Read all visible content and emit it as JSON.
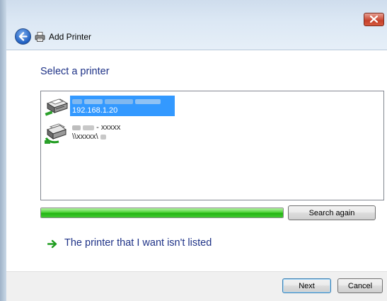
{
  "window": {
    "title": "Add Printer",
    "close_icon": "close-icon",
    "back_icon": "back-arrow-icon"
  },
  "main": {
    "heading": "Select a printer",
    "printers": [
      {
        "name_redacted": true,
        "address": "192.168.1.20",
        "selected": true,
        "icon": "network-printer-icon"
      },
      {
        "name_suffix": "- xxxxx",
        "path": "\\\\xxxxx\\",
        "selected": false,
        "icon": "shared-printer-icon"
      }
    ],
    "search_progress": 1.0,
    "search_again_label": "Search again",
    "not_listed_label": "The printer that I want isn't listed",
    "not_listed_icon": "green-arrow-icon"
  },
  "footer": {
    "next_label": "Next",
    "cancel_label": "Cancel"
  },
  "colors": {
    "heading": "#1e3287",
    "selection": "#3399ff",
    "progress": "#23b312",
    "close_button": "#c6402a"
  }
}
